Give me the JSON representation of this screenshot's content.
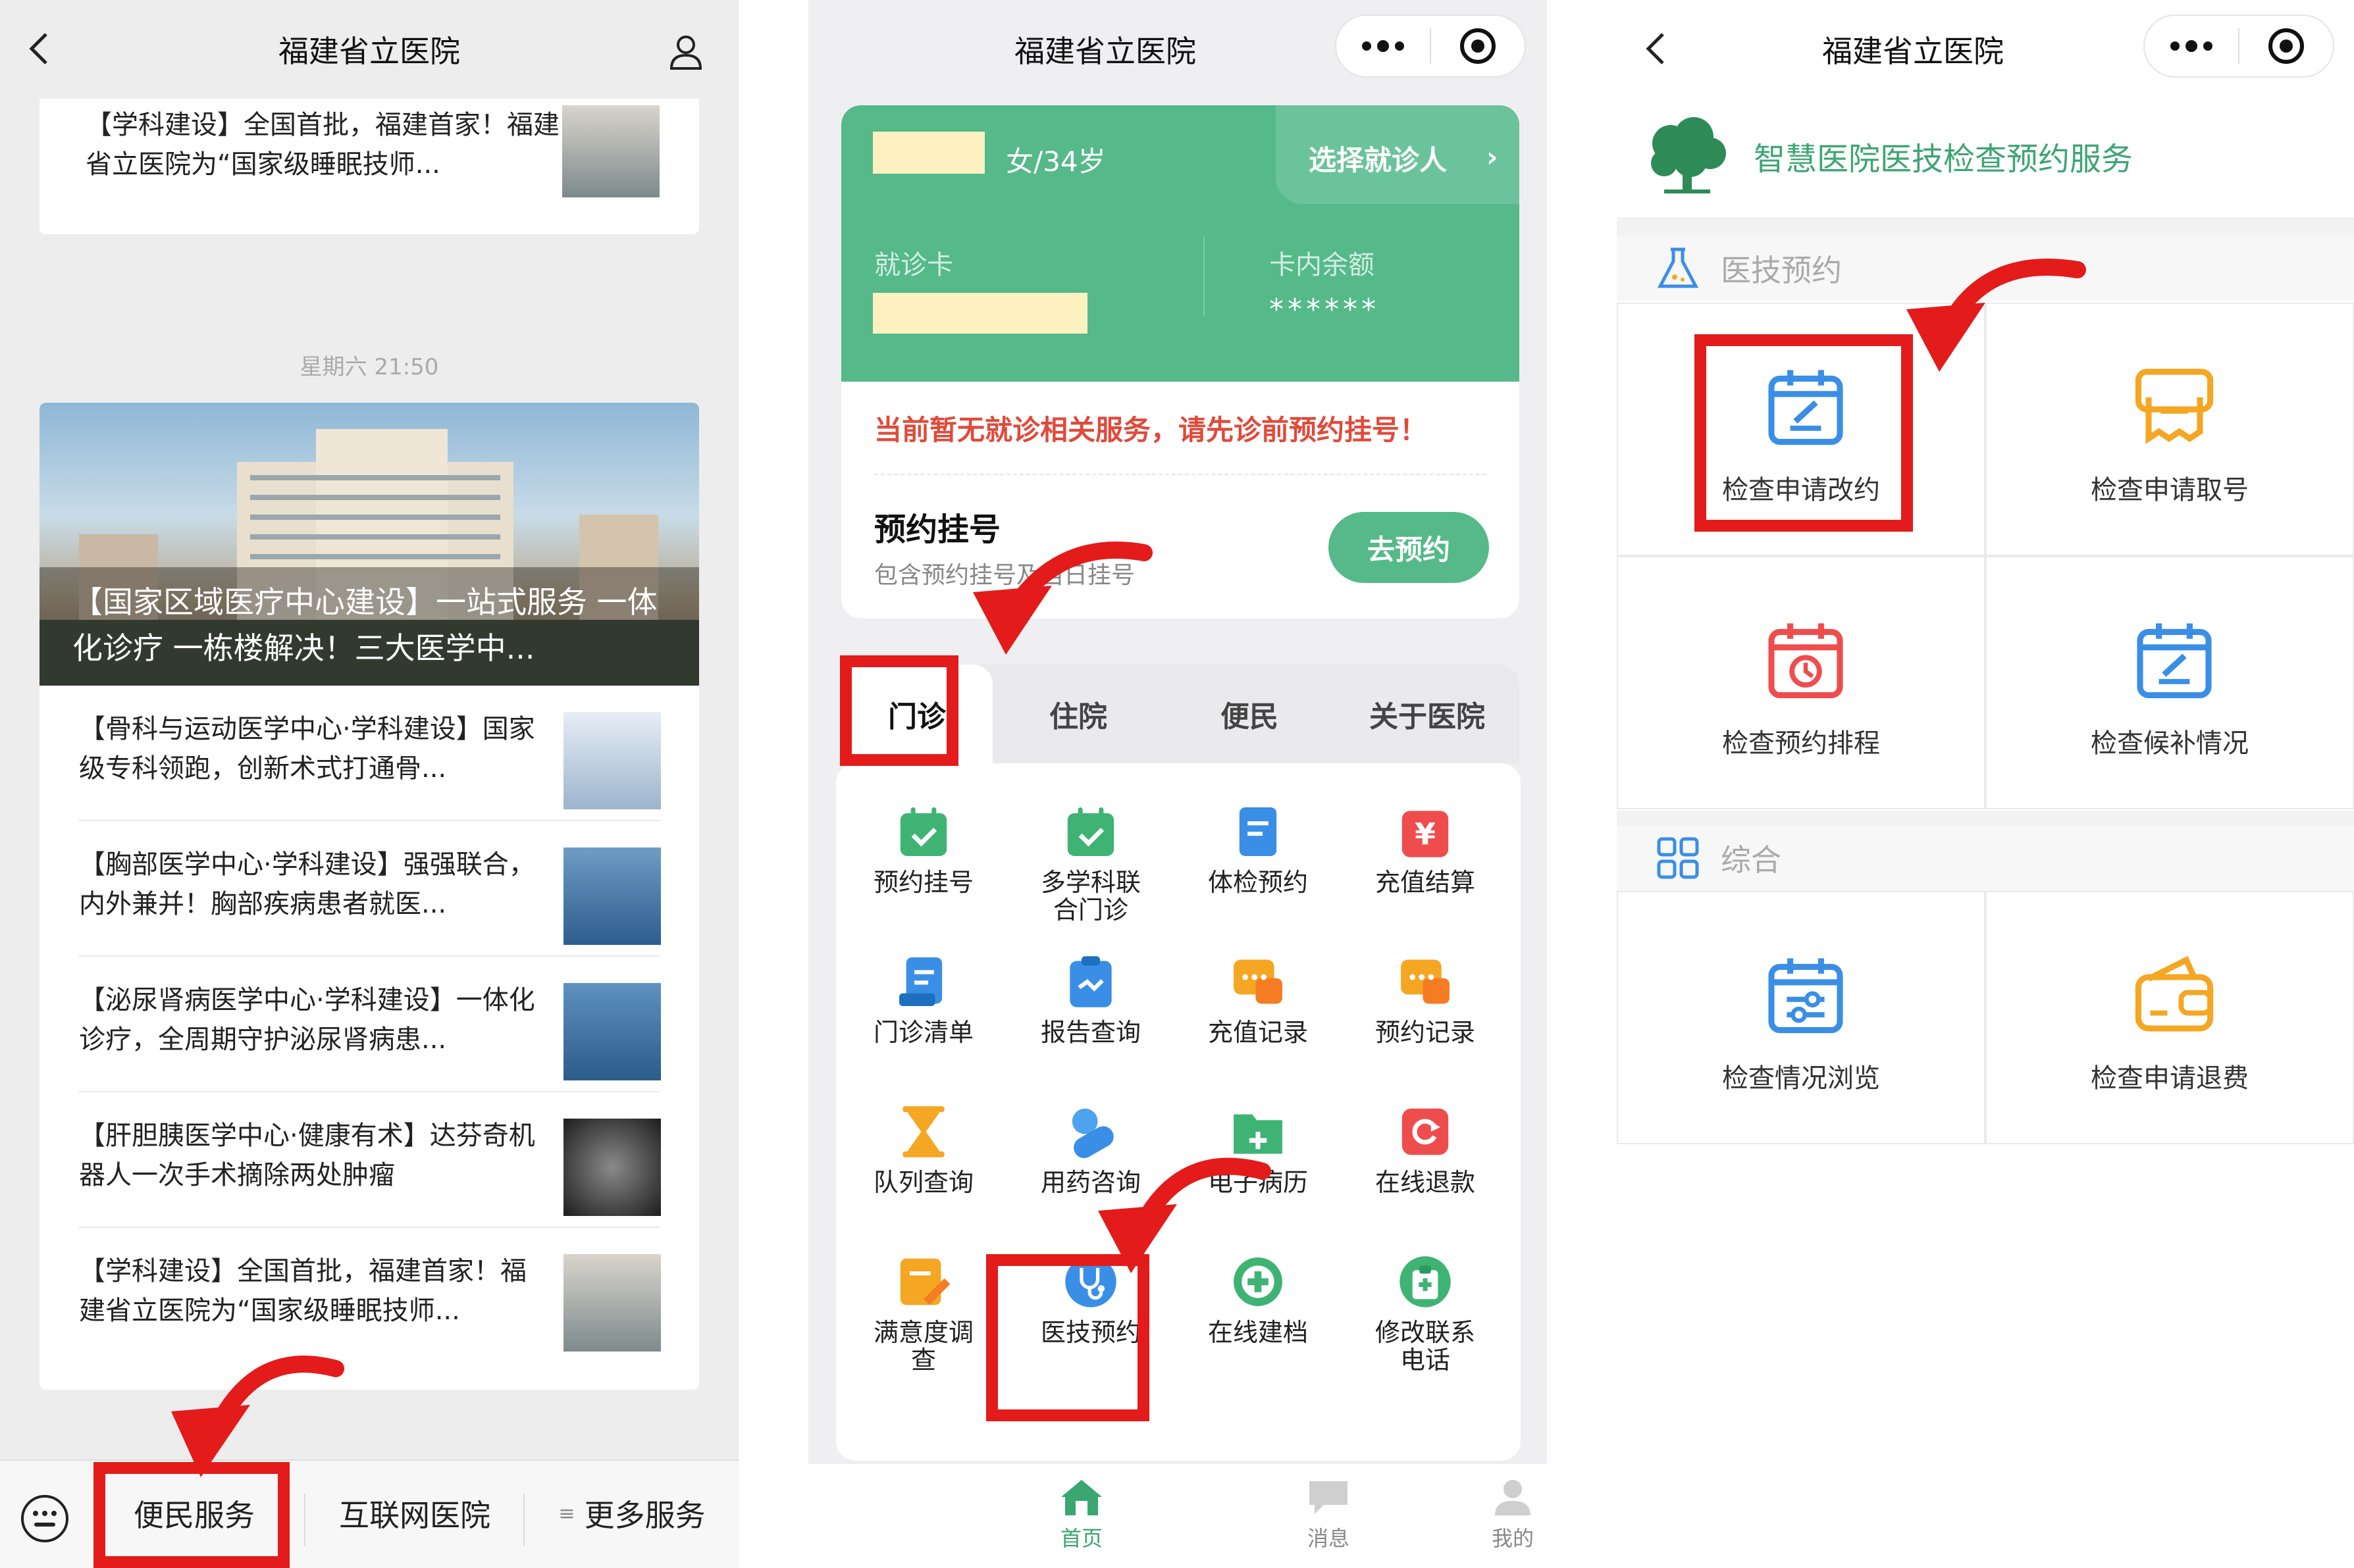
{
  "panel1": {
    "title": "福建省立医院",
    "top_article": "【学科建设】全国首批，福建首家！福建省立医院为“国家级睡眠技师...",
    "timestamp": "星期六 21:50",
    "hero_caption": "【国家区域医疗中心建设】一站式服务 一体化诊疗 一栋楼解决！三大医学中...",
    "articles": [
      {
        "title": "【骨科与运动医学中心·学科建设】国家级专科领跑，创新术式打通骨..."
      },
      {
        "title": "【胸部医学中心·学科建设】强强联合，内外兼并！胸部疾病患者就医..."
      },
      {
        "title": "【泌尿肾病医学中心·学科建设】一体化诊疗，全周期守护泌尿肾病患..."
      },
      {
        "title": "【肝胆胰医学中心·健康有术】达芬奇机器人一次手术摘除两处肿瘤"
      },
      {
        "title": "【学科建设】全国首批，福建首家！福建省立医院为“国家级睡眠技师..."
      }
    ],
    "menu": [
      "便民服务",
      "互联网医院",
      "更多服务"
    ]
  },
  "panel2": {
    "title": "福建省立医院",
    "patient_info": "女/34岁",
    "select_patient": "选择就诊人",
    "card_label": "就诊卡",
    "balance_label": "卡内余额",
    "balance_value": "******",
    "notice": "当前暂无就诊相关服务，请先诊前预约挂号！",
    "booking_title": "预约挂号",
    "booking_sub": "包含预约挂号及当日挂号",
    "booking_button": "去预约",
    "tabs": [
      "门诊",
      "住院",
      "便民",
      "关于医院"
    ],
    "grid": [
      {
        "label": "预约挂号",
        "icon": "calendar-check-icon",
        "color": "#3fb374"
      },
      {
        "label": "多学科联合门诊",
        "icon": "calendar-check-icon",
        "color": "#3fb374"
      },
      {
        "label": "体检预约",
        "icon": "document-icon",
        "color": "#3a8ee6"
      },
      {
        "label": "充值结算",
        "icon": "yuan-icon",
        "color": "#ef4d4d"
      },
      {
        "label": "门诊清单",
        "icon": "list-icon",
        "color": "#3a8ee6"
      },
      {
        "label": "报告查询",
        "icon": "clipboard-icon",
        "color": "#3a8ee6"
      },
      {
        "label": "充值记录",
        "icon": "chat-icon",
        "color": "#f5a623"
      },
      {
        "label": "预约记录",
        "icon": "chat-icon",
        "color": "#f5a623"
      },
      {
        "label": "队列查询",
        "icon": "hourglass-icon",
        "color": "#f5a623"
      },
      {
        "label": "用药咨询",
        "icon": "pill-icon",
        "color": "#3a8ee6"
      },
      {
        "label": "电子病历",
        "icon": "folder-plus-icon",
        "color": "#3fb374"
      },
      {
        "label": "在线退款",
        "icon": "refund-icon",
        "color": "#ef4d4d"
      },
      {
        "label": "满意度调查",
        "icon": "edit-icon",
        "color": "#f5a623"
      },
      {
        "label": "医技预约",
        "icon": "stethoscope-icon",
        "color": "#3a8ee6"
      },
      {
        "label": "在线建档",
        "icon": "plus-circle-icon",
        "color": "#3fb374"
      },
      {
        "label": "修改联系电话",
        "icon": "id-card-icon",
        "color": "#3fb374"
      }
    ],
    "tabbar": [
      "首页",
      "消息",
      "我的"
    ]
  },
  "panel3": {
    "title": "福建省立医院",
    "banner": "智慧医院医技检查预约服务",
    "section1": "医技预约",
    "section2": "综合",
    "items1": [
      {
        "label": "检查申请改约",
        "icon": "calendar-edit-icon",
        "color": "#3a8ee6"
      },
      {
        "label": "检查申请取号",
        "icon": "ticket-icon",
        "color": "#f5a623"
      },
      {
        "label": "检查预约排程",
        "icon": "calendar-clock-icon",
        "color": "#ef4d4d"
      },
      {
        "label": "检查候补情况",
        "icon": "calendar-edit-icon",
        "color": "#3a8ee6"
      }
    ],
    "items2": [
      {
        "label": "检查情况浏览",
        "icon": "calendar-settings-icon",
        "color": "#3a8ee6"
      },
      {
        "label": "检查申请退费",
        "icon": "wallet-icon",
        "color": "#f5a623"
      }
    ]
  },
  "colors": {
    "green": "#55b98a",
    "highlight": "#e31b1b",
    "notice": "#e04a3a"
  }
}
